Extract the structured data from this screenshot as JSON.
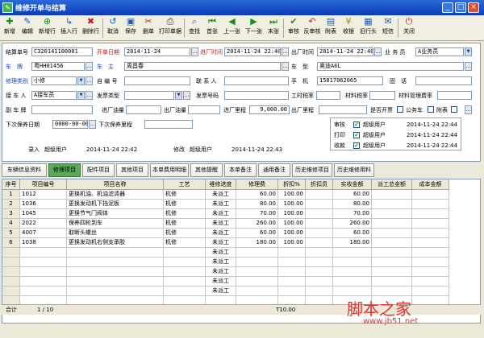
{
  "window": {
    "title": "维修开单与结算"
  },
  "toolbar": [
    "新增",
    "编辑",
    "新增行",
    "插入行",
    "删除行",
    "取消",
    "保存",
    "删单",
    "打印单据",
    "查找",
    "首张",
    "上一张",
    "下一张",
    "末张",
    "审核",
    "反审核",
    "附表",
    "收银",
    "旧行头",
    "短信",
    "关闭"
  ],
  "form": {
    "l_settle_no": "结算单号",
    "settle_no": "C320141100001",
    "l_open_date": "开单日期",
    "open_date": "2014-11-24",
    "l_in_time": "进厂时间",
    "in_time": "2014-11-24 22:40",
    "l_out_time": "出厂时间",
    "out_time": "2014-11-24 22:40",
    "l_clerk": "业 务 员",
    "clerk": "A业务员",
    "l_plate": "车　牌",
    "plate": "粤HH01456",
    "l_owner": "车　主",
    "owner": "周昌春",
    "l_model": "车　型",
    "model": "奥迪A6L",
    "l_repair_type": "修理类别",
    "repair_type": "小修",
    "l_self_no": "自 编 号",
    "l_contact": "联 系 人",
    "l_mobile": "手　机",
    "mobile": "15817062065",
    "l_phone": "固　话",
    "l_receiver": "接 车 人",
    "receiver": "A接车员",
    "l_invoice_type": "发票类型",
    "l_invoice_no": "发票号码",
    "l_labor_rate": "工时税率",
    "l_mat_rate": "材料税率",
    "l_mat_fee": "材料管理费率",
    "l_sub_plate": "副 车 牌",
    "l_in_fuel": "进厂油量",
    "l_out_fuel": "出厂油量",
    "l_in_mileage": "进厂里程",
    "in_mileage": "9,000.00",
    "l_out_mileage": "出厂里程",
    "l_warranty": "是否开票",
    "l_public": "公务车",
    "l_attach": "附表",
    "l_next_date": "下次保养日期",
    "next_date": "0000-00-00",
    "l_next_mileage": "下次保养里程",
    "l_entry": "录入",
    "entry_user": "超级用户",
    "entry_time": "2014-11-24 22:42",
    "l_modify": "修改",
    "modify_user": "超级用户",
    "modify_time": "2014-11-24 22:43"
  },
  "audit": [
    {
      "label": "审核",
      "user": "超级用户",
      "time": "2014-11-24 22:44"
    },
    {
      "label": "打印",
      "user": "超级用户",
      "time": "2014-11-24 22:44"
    },
    {
      "label": "收款",
      "user": "超级用户",
      "time": "2014-11-24 22:44"
    }
  ],
  "tabs": [
    "车辆信息资料",
    "修理项目",
    "配件项目",
    "其他项目",
    "本单费用明细",
    "其他提醒",
    "本单备注",
    "通用备注",
    "历史维修项目",
    "历史维修用料"
  ],
  "grid": {
    "headers": [
      "序号",
      "项目编号",
      "项目名称",
      "工艺",
      "维修进度",
      "修理费",
      "折扣%",
      "折扣员",
      "实收金额",
      "派工总金额",
      "成本金额"
    ],
    "rows": [
      [
        "1",
        "1012",
        "更换机油、机油滤清器",
        "机修",
        "未派工",
        "60.00",
        "100.00",
        "",
        "60.00",
        "",
        ""
      ],
      [
        "2",
        "1036",
        "更换发动机下挡泥板",
        "机修",
        "未派工",
        "80.00",
        "100.00",
        "",
        "80.00",
        "",
        ""
      ],
      [
        "3",
        "1045",
        "更换节气门阀体",
        "机修",
        "未派工",
        "70.00",
        "100.00",
        "",
        "70.00",
        "",
        ""
      ],
      [
        "4",
        "2022",
        "保养四轮到车",
        "机修",
        "未派工",
        "260.00",
        "100.00",
        "",
        "260.00",
        "",
        ""
      ],
      [
        "5",
        "4007",
        "取断头螺丝",
        "机修",
        "未派工",
        "60.00",
        "100.00",
        "",
        "60.00",
        "",
        ""
      ],
      [
        "6",
        "1038",
        "更换发动机右侧支承胶",
        "机修",
        "未派工",
        "180.00",
        "100.00",
        "",
        "180.00",
        "",
        ""
      ]
    ],
    "pending": "未派工",
    "total_label": "合计",
    "page": "1 / 10",
    "total": "T10.00"
  },
  "watermark": {
    "text": "脚本之家",
    "url": "www.jb51.net"
  }
}
